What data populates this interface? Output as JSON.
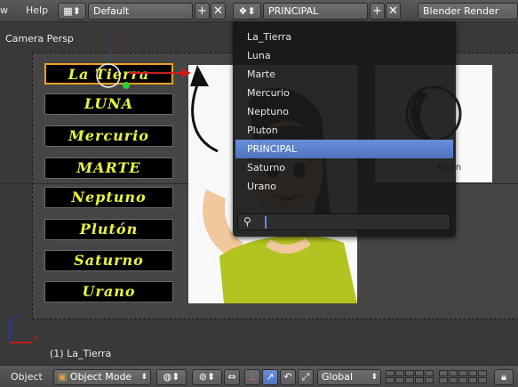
{
  "header": {
    "menu_partial": "w",
    "help": "Help",
    "screen_layout": "Default",
    "scene": "PRINCIPAL",
    "render_engine": "Blender Render"
  },
  "viewport": {
    "view_label": "Camera Persp",
    "object_label": "(1) La_Tierra",
    "planet_buttons": [
      "La Tierra",
      "LUNA",
      "Mercurio",
      "MARTE",
      "Neptuno",
      "Plutón",
      "Saturno",
      "Urano"
    ],
    "moon_text": "Moon"
  },
  "scene_dropdown": {
    "items": [
      "La_Tierra",
      "Luna",
      "Marte",
      "Mercurio",
      "Neptuno",
      "Pluton",
      "PRINCIPAL",
      "Saturno",
      "Urano"
    ],
    "active_index": 6,
    "search_value": ""
  },
  "footer": {
    "object_menu": "Object",
    "mode": "Object Mode",
    "pivot": "Global"
  },
  "colors": {
    "accent": "#5680d0",
    "planet_text": "#e9f53a",
    "selection_outline": "#f0a020"
  }
}
